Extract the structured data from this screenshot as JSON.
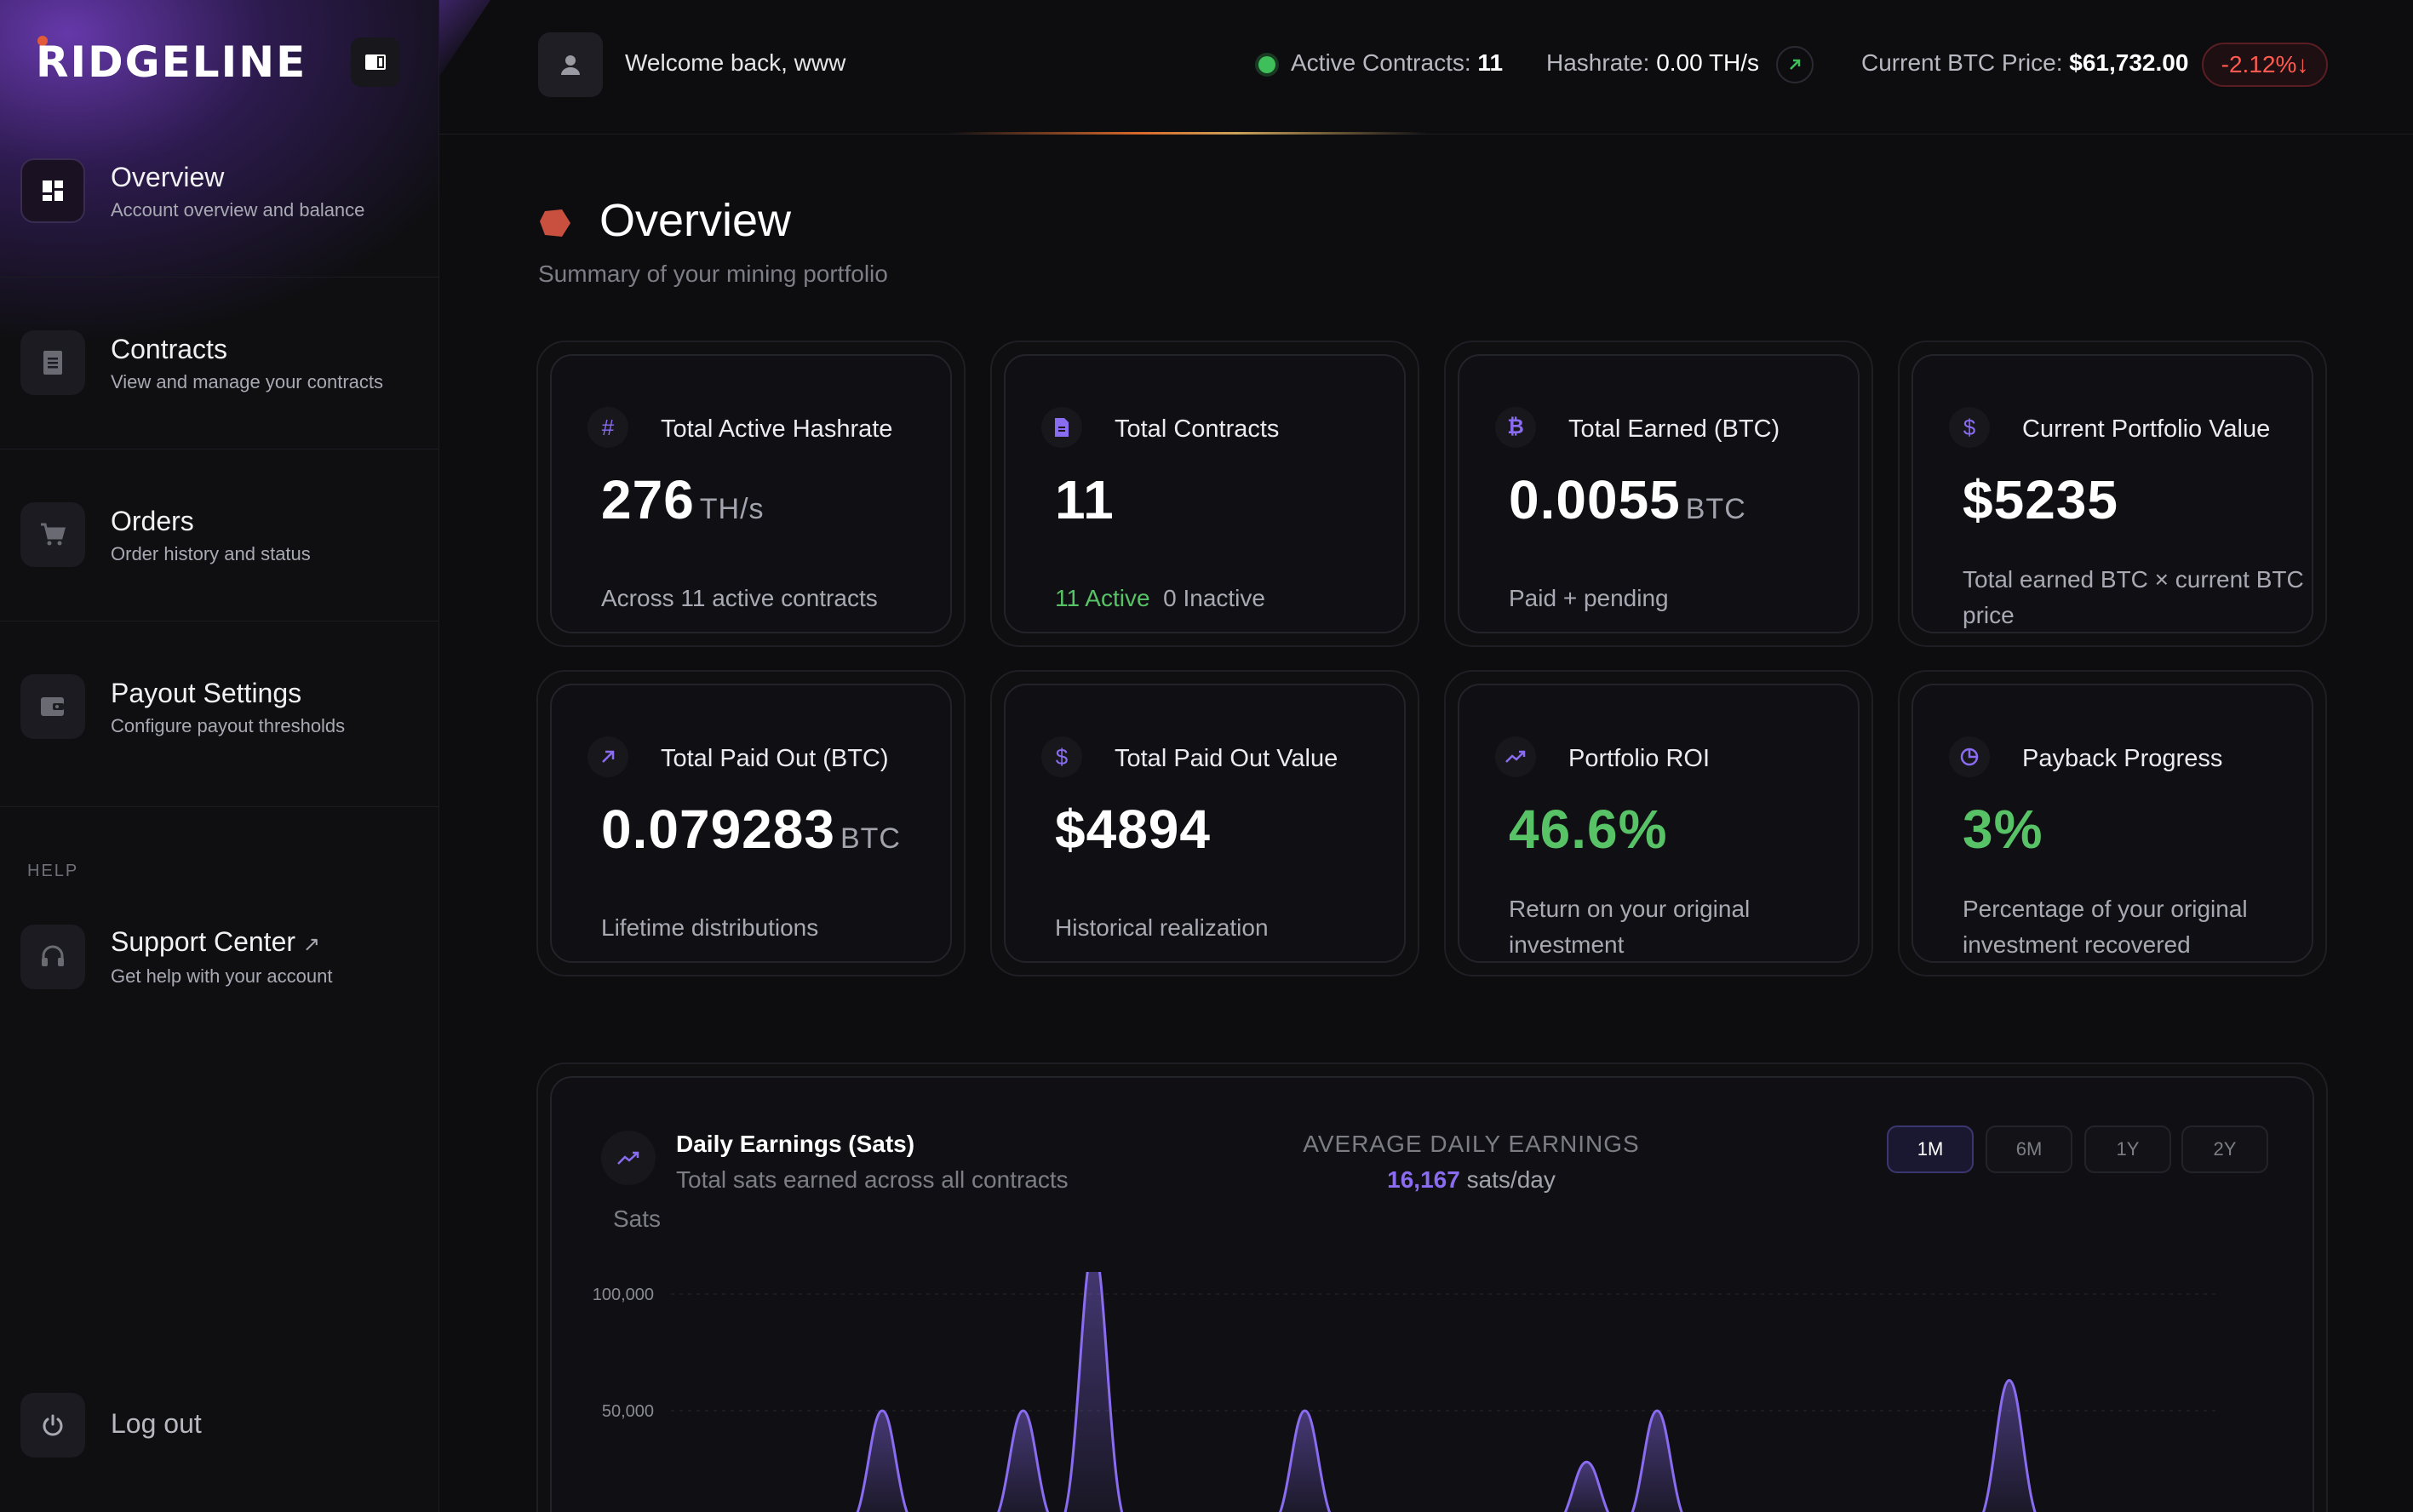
{
  "brand": {
    "name": "RIDGELINE",
    "accent": "#e25b3a"
  },
  "sidebar": {
    "items": [
      {
        "title": "Overview",
        "subtitle": "Account overview and balance",
        "icon": "dashboard-icon",
        "active": true
      },
      {
        "title": "Contracts",
        "subtitle": "View and manage your contracts",
        "icon": "document-icon"
      },
      {
        "title": "Orders",
        "subtitle": "Order history and status",
        "icon": "cart-icon"
      },
      {
        "title": "Payout Settings",
        "subtitle": "Configure payout thresholds",
        "icon": "wallet-icon"
      }
    ],
    "help_label": "HELP",
    "support": {
      "title": "Support Center",
      "subtitle": "Get help with your account",
      "icon": "headset-icon"
    },
    "logout_label": "Log out"
  },
  "topbar": {
    "welcome": "Welcome back, www",
    "active_contracts_label": "Active Contracts:",
    "active_contracts_value": "11",
    "hashrate_label": "Hashrate:",
    "hashrate_value": "0.00 TH/s",
    "btc_price_label": "Current BTC Price:",
    "btc_price_value": "$61,732.00",
    "btc_change": "-2.12%↓"
  },
  "page": {
    "title": "Overview",
    "subtitle": "Summary of your mining portfolio"
  },
  "cards": [
    {
      "title": "Total Active Hashrate",
      "value": "276",
      "unit": "TH/s",
      "desc": "Across 11 active contracts",
      "icon": "hash-icon"
    },
    {
      "title": "Total Contracts",
      "value": "11",
      "active_text": "11 Active",
      "inactive_text": "0 Inactive",
      "icon": "document-icon"
    },
    {
      "title": "Total Earned (BTC)",
      "value": "0.0055",
      "unit": "BTC",
      "desc": "Paid + pending",
      "icon": "bitcoin-icon"
    },
    {
      "title": "Current Portfolio Value",
      "value": "$5235",
      "desc": "Total earned BTC × current BTC price",
      "icon": "dollar-icon"
    },
    {
      "title": "Total Paid Out (BTC)",
      "value": "0.079283",
      "unit": "BTC",
      "desc": "Lifetime distributions",
      "icon": "arrow-up-right-icon"
    },
    {
      "title": "Total Paid Out Value",
      "value": "$4894",
      "desc": "Historical realization",
      "icon": "dollar-icon"
    },
    {
      "title": "Portfolio ROI",
      "value": "46.6%",
      "desc": "Return on your original investment",
      "icon": "trending-up-icon"
    },
    {
      "title": "Payback Progress",
      "value": "3%",
      "desc": "Percentage of your original investment recovered",
      "icon": "pie-icon"
    }
  ],
  "earnings": {
    "title": "Daily Earnings (Sats)",
    "subtitle": "Total sats earned across all contracts",
    "avg_label": "AVERAGE DAILY EARNINGS",
    "avg_value": "16,167",
    "avg_unit": "sats/day",
    "ranges": [
      "1M",
      "6M",
      "1Y",
      "2Y"
    ],
    "active_range": "1M",
    "y_title": "Sats"
  },
  "chart_data": {
    "type": "area",
    "ylabel": "Sats",
    "y_ticks": [
      "100,000",
      "50,000"
    ],
    "y_tick_values": [
      100000,
      50000
    ],
    "series": [
      {
        "color": "#8a6cf0",
        "peaks": [
          {
            "x": 3,
            "value": 50000
          },
          {
            "x": 5,
            "value": 50000
          },
          {
            "x": 6,
            "value": 120000
          },
          {
            "x": 9,
            "value": 50000
          },
          {
            "x": 13,
            "value": 28000
          },
          {
            "x": 14,
            "value": 50000
          },
          {
            "x": 19,
            "value": 63000
          }
        ]
      }
    ],
    "x_range": [
      0,
      22
    ]
  }
}
